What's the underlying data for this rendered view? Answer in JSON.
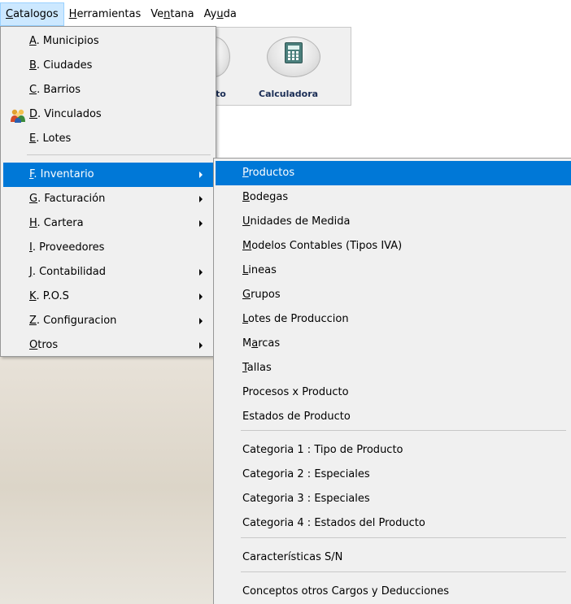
{
  "menubar": [
    {
      "key": "C",
      "rest": "atalogos",
      "active": true
    },
    {
      "key": "H",
      "rest": "erramientas",
      "active": false
    },
    {
      "pre": "Ve",
      "key": "n",
      "rest": "tana",
      "active": false
    },
    {
      "pre": "Ay",
      "key": "u",
      "rest": "da",
      "active": false
    }
  ],
  "toolbar": {
    "prev_label": "to",
    "calc_label": "Calculadora"
  },
  "main_menu": [
    {
      "key": "A",
      "rest": ". Municipios",
      "submenu": false,
      "highlighted": false
    },
    {
      "key": "B",
      "rest": ". Ciudades",
      "submenu": false,
      "highlighted": false
    },
    {
      "key": "C",
      "rest": ". Barrios",
      "submenu": false,
      "highlighted": false
    },
    {
      "key": "D",
      "rest": ". Vinculados",
      "submenu": false,
      "highlighted": false,
      "icon": "people-group-icon"
    },
    {
      "key": "E",
      "rest": ". Lotes",
      "submenu": false,
      "highlighted": false
    },
    {
      "key": "F",
      "rest": ". Inventario",
      "submenu": true,
      "highlighted": true
    },
    {
      "key": "G",
      "rest": ". Facturación",
      "submenu": true,
      "highlighted": false
    },
    {
      "key": "H",
      "rest": ". Cartera",
      "submenu": true,
      "highlighted": false
    },
    {
      "key": "I",
      "rest": ". Proveedores",
      "submenu": false,
      "highlighted": false
    },
    {
      "key": "J",
      "rest": ". Contabilidad",
      "submenu": true,
      "highlighted": false
    },
    {
      "key": "K",
      "rest": ". P.O.S",
      "submenu": true,
      "highlighted": false
    },
    {
      "key": "Z",
      "rest": ". Configuracion",
      "submenu": true,
      "highlighted": false
    },
    {
      "key": "O",
      "rest": "tros",
      "submenu": true,
      "highlighted": false
    }
  ],
  "sub_menu": [
    {
      "key": "P",
      "rest": "roductos",
      "highlighted": true
    },
    {
      "key": "B",
      "rest": "odegas",
      "highlighted": false
    },
    {
      "key": "U",
      "rest": "nidades de Medida",
      "highlighted": false
    },
    {
      "key": "M",
      "rest": "odelos Contables (Tipos IVA)",
      "highlighted": false
    },
    {
      "key": "L",
      "rest": "ineas",
      "highlighted": false
    },
    {
      "key": "G",
      "rest": "rupos",
      "highlighted": false
    },
    {
      "key": "L",
      "rest": "otes de Produccion",
      "highlighted": false
    },
    {
      "pre": "M",
      "key": "a",
      "rest": "rcas",
      "highlighted": false
    },
    {
      "key": "T",
      "rest": "allas",
      "highlighted": false
    },
    {
      "key": "",
      "rest": "Procesos x Producto",
      "highlighted": false
    },
    {
      "key": "",
      "rest": "Estados de Producto",
      "highlighted": false
    },
    {
      "key": "",
      "rest": "Categoria 1 : Tipo de Producto",
      "highlighted": false
    },
    {
      "key": "",
      "rest": "Categoria 2 : Especiales",
      "highlighted": false
    },
    {
      "key": "",
      "rest": "Categoria 3 : Especiales",
      "highlighted": false
    },
    {
      "key": "",
      "rest": "Categoria 4 : Estados del Producto",
      "highlighted": false
    },
    {
      "key": "",
      "rest": "Características S/N",
      "highlighted": false
    },
    {
      "key": "",
      "rest": "Conceptos otros Cargos y Deducciones",
      "highlighted": false
    }
  ],
  "colors": {
    "highlight": "#0078d7",
    "menu_bg": "#f0f0f0",
    "menubar_active": "#cce8ff"
  }
}
